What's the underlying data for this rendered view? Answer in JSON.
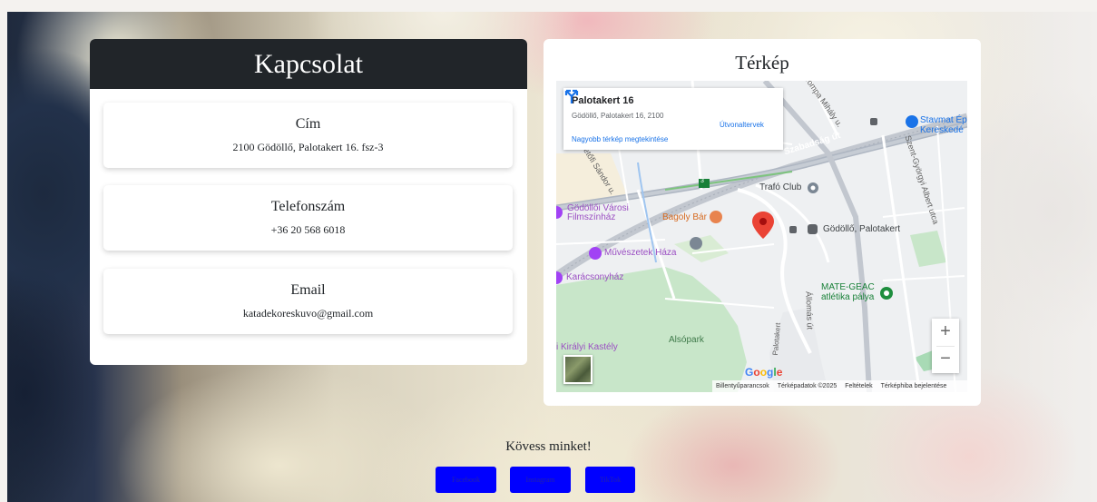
{
  "contact": {
    "title": "Kapcsolat",
    "address": {
      "label": "Cím",
      "value": "2100 Gödöllő, Palotakert 16. fsz-3"
    },
    "phone": {
      "label": "Telefonszám",
      "value": "+36 20 568 6018"
    },
    "email": {
      "label": "Email",
      "value": "katadekoreskuvo@gmail.com"
    }
  },
  "map": {
    "title": "Térkép",
    "popup": {
      "place": "Palotakert 16",
      "address": "Gödöllő, Palotakert 16, 2100",
      "directions": "Útvonaltervek",
      "larger_map": "Nagyobb térkép megtekintése"
    },
    "labels": {
      "szabadsag": "Szabadság út",
      "tompa": "Tompa Mihály u.",
      "petofi": "Petőfi Sándor u.",
      "stavmat": "Stavmat Ép",
      "stavmat2": "Kereskedé",
      "trafo": "Trafó Club",
      "szent_gyorgyi": "Szent-Györgyi Albert utca",
      "varosi_1": "Gödöllői Városi",
      "varosi_2": "Filmszínház",
      "bagoly": "Bagoly Bár",
      "palotakert_stop": "Gödöllő, Palotakert",
      "muveszetek": "Művészetek Háza",
      "karacsony": "Karácsonyház",
      "mate_1": "MATE-GEAC",
      "mate_2": "atlétika pálya",
      "allomas": "Állomás út",
      "palotakert_road": "Palotakert",
      "alsopark": "Alsópark",
      "kiraly": "i Királyi Kastély",
      "route_number": "3"
    },
    "zoom_in": "+",
    "zoom_out": "−",
    "google": "Google",
    "attribution": {
      "shortcuts": "Billentyűparancsok",
      "mapdata": "Térképadatok ©2025",
      "terms": "Feltételek",
      "report": "Térképhiba bejelentése"
    }
  },
  "footer": {
    "follow": "Kövess minket!",
    "buttons": [
      "Facebook",
      "Instagram",
      "TikTok"
    ]
  },
  "colors": {
    "header_bg": "#212529",
    "social_button": "#0000ff",
    "map_pin": "#ea4335",
    "link": "#1a73e8"
  }
}
